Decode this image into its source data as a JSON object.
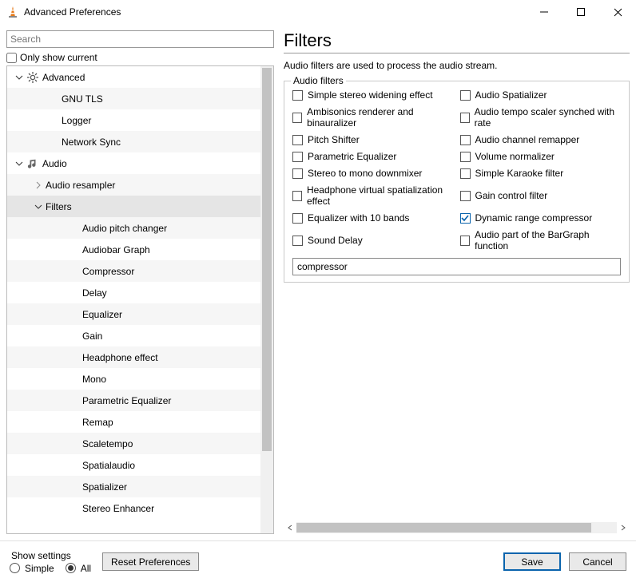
{
  "window": {
    "title": "Advanced Preferences"
  },
  "search": {
    "placeholder": "Search"
  },
  "only_show_current": {
    "label": "Only show current",
    "checked": false
  },
  "tree": {
    "items": [
      {
        "level": 1,
        "expand": "down",
        "icon": "gear",
        "label": "Advanced"
      },
      {
        "level": 3,
        "label": "GNU TLS"
      },
      {
        "level": 3,
        "label": "Logger"
      },
      {
        "level": 3,
        "label": "Network Sync"
      },
      {
        "level": 1,
        "expand": "down",
        "icon": "audio",
        "label": "Audio"
      },
      {
        "level": 2,
        "expand": "right",
        "label": "Audio resampler"
      },
      {
        "level": 2,
        "expand": "down",
        "label": "Filters",
        "selected": true
      },
      {
        "level": 4,
        "label": "Audio pitch changer"
      },
      {
        "level": 4,
        "label": "Audiobar Graph"
      },
      {
        "level": 4,
        "label": "Compressor"
      },
      {
        "level": 4,
        "label": "Delay"
      },
      {
        "level": 4,
        "label": "Equalizer"
      },
      {
        "level": 4,
        "label": "Gain"
      },
      {
        "level": 4,
        "label": "Headphone effect"
      },
      {
        "level": 4,
        "label": "Mono"
      },
      {
        "level": 4,
        "label": "Parametric Equalizer"
      },
      {
        "level": 4,
        "label": "Remap"
      },
      {
        "level": 4,
        "label": "Scaletempo"
      },
      {
        "level": 4,
        "label": "Spatialaudio"
      },
      {
        "level": 4,
        "label": "Spatializer"
      },
      {
        "level": 4,
        "label": "Stereo Enhancer"
      }
    ]
  },
  "page": {
    "title": "Filters",
    "description": "Audio filters are used to process the audio stream.",
    "fieldset_legend": "Audio filters",
    "filter_text": "compressor",
    "checkboxes": [
      {
        "label": "Simple stereo widening effect",
        "checked": false
      },
      {
        "label": "Audio Spatializer",
        "checked": false
      },
      {
        "label": "Ambisonics renderer and binauralizer",
        "checked": false
      },
      {
        "label": "Audio tempo scaler synched with rate",
        "checked": false
      },
      {
        "label": "Pitch Shifter",
        "checked": false
      },
      {
        "label": "Audio channel remapper",
        "checked": false
      },
      {
        "label": "Parametric Equalizer",
        "checked": false
      },
      {
        "label": "Volume normalizer",
        "checked": false
      },
      {
        "label": "Stereo to mono downmixer",
        "checked": false
      },
      {
        "label": "Simple Karaoke filter",
        "checked": false
      },
      {
        "label": "Headphone virtual spatialization effect",
        "checked": false
      },
      {
        "label": "Gain control filter",
        "checked": false
      },
      {
        "label": "Equalizer with 10 bands",
        "checked": false
      },
      {
        "label": "Dynamic range compressor",
        "checked": true
      },
      {
        "label": "Sound Delay",
        "checked": false
      },
      {
        "label": "Audio part of the BarGraph function",
        "checked": false
      }
    ]
  },
  "bottom": {
    "show_settings_label": "Show settings",
    "simple_label": "Simple",
    "all_label": "All",
    "mode": "All",
    "reset": "Reset Preferences",
    "save": "Save",
    "cancel": "Cancel"
  }
}
